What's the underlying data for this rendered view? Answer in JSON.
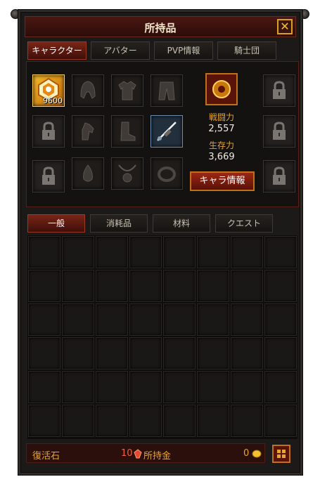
{
  "window": {
    "title": "所持品",
    "close_symbol": "✕"
  },
  "equipment_tabs": [
    "キャラクター",
    "アバター",
    "PVP情報",
    "騎士団"
  ],
  "equipment_active_tab": "キャラクター",
  "character": {
    "rank_badge": "9600",
    "stats": [
      {
        "label": "戦闘力",
        "value": "2,557"
      },
      {
        "label": "生存力",
        "value": "3,669"
      }
    ],
    "info_button": "キャラ情報",
    "slot_icons": [
      "helmet-icon",
      "armor-icon",
      "pants-icon",
      "gloves-icon",
      "boots-icon",
      "weapon-icon",
      "amulet-icon",
      "necklace-icon",
      "ring-icon",
      "lock-icon",
      "medal-icon"
    ]
  },
  "inventory_tabs": [
    "一般",
    "消耗品",
    "材料",
    "クエスト"
  ],
  "inventory_active_tab": "一般",
  "inventory_grid": {
    "columns": 8,
    "rows": 6,
    "filled": 0
  },
  "footer": {
    "revive_label": "復活石",
    "revive_value": "10",
    "money_label": "所持金",
    "money_value": "0"
  },
  "colors": {
    "accent": "#e6a52e",
    "title_bar": "#3a110d",
    "active_tab": "#7a2516",
    "gold": "#f2c232"
  }
}
